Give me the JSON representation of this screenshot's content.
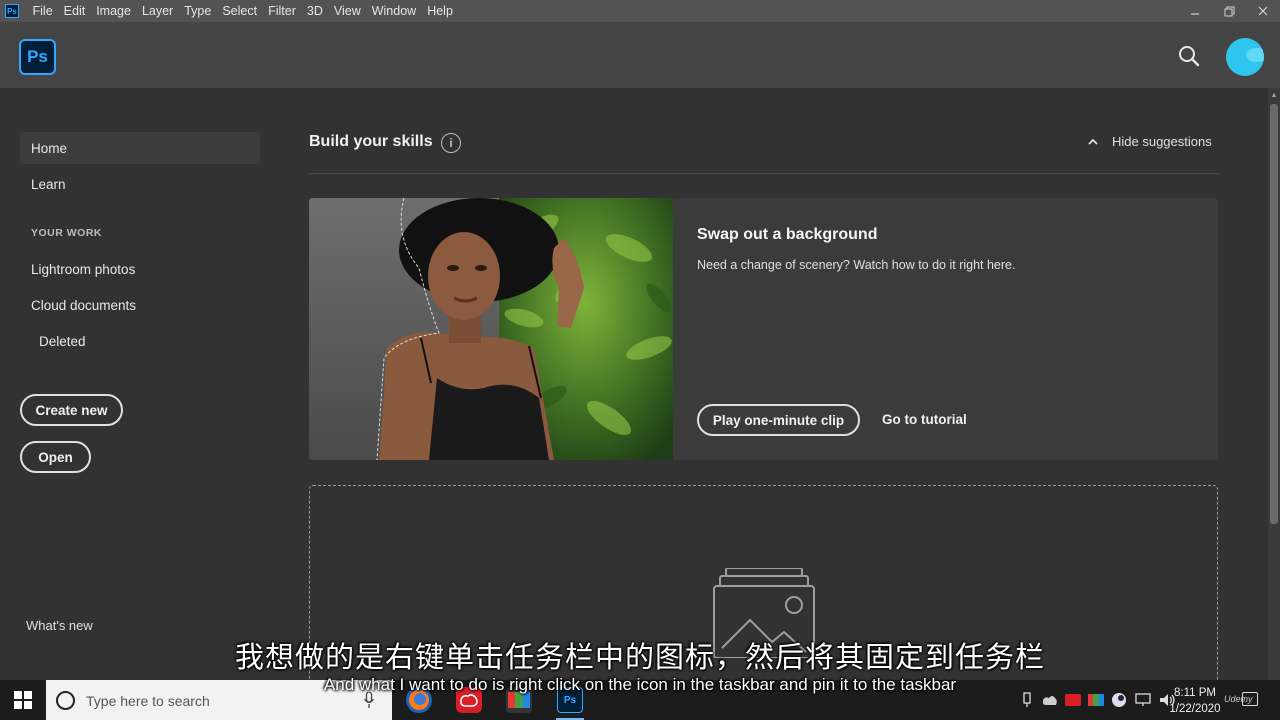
{
  "menubar": {
    "app_icon": "Ps",
    "items": [
      "File",
      "Edit",
      "Image",
      "Layer",
      "Type",
      "Select",
      "Filter",
      "3D",
      "View",
      "Window",
      "Help"
    ],
    "controls": [
      "minimize-icon",
      "restore-icon",
      "close-icon"
    ]
  },
  "header": {
    "logo": "Ps",
    "search_icon": "search-icon",
    "avatar_color": "#2ec6ee"
  },
  "sidebar": {
    "home": "Home",
    "learn": "Learn",
    "section_label": "YOUR WORK",
    "lightroom": "Lightroom photos",
    "cloud": "Cloud documents",
    "deleted": "Deleted",
    "create_new": "Create new",
    "open": "Open",
    "whats_new": "What's new"
  },
  "main": {
    "skills_title": "Build your skills",
    "hide_suggestions": "Hide suggestions",
    "card": {
      "title": "Swap out a background",
      "description": "Need a change of scenery? Watch how to do it right here.",
      "play_button": "Play one-minute clip",
      "tutorial_link": "Go to tutorial"
    }
  },
  "subtitles": {
    "chinese": "我想做的是右键单击任务栏中的图标，然后将其固定到任务栏",
    "english": "And what I want to do is right click on the icon in the taskbar and pin it to the taskbar"
  },
  "taskbar": {
    "search_placeholder": "Type here to search",
    "time": "8:11 PM",
    "date": "1/22/2020",
    "watermark": "Udemy",
    "apps": [
      "firefox-icon",
      "creative-cloud-icon",
      "color-app-icon",
      "photoshop-icon"
    ]
  },
  "colors": {
    "accent": "#31a8ff",
    "background": "#323232",
    "header": "#444444"
  }
}
